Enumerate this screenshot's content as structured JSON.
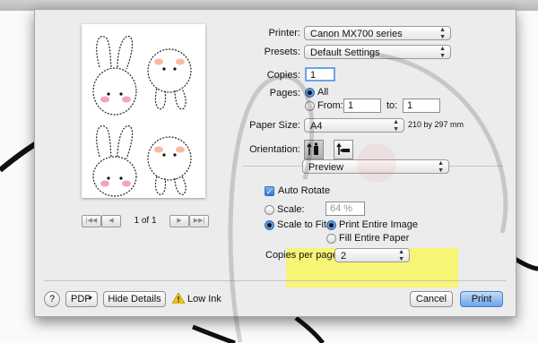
{
  "printer": {
    "label": "Printer:",
    "value": "Canon MX700 series"
  },
  "presets": {
    "label": "Presets:",
    "value": "Default Settings"
  },
  "copies": {
    "label": "Copies:",
    "value": "1"
  },
  "pages": {
    "label": "Pages:",
    "all_label": "All",
    "from_label": "From:",
    "from_value": "1",
    "to_label": "to:",
    "to_value": "1"
  },
  "paper_size": {
    "label": "Paper Size:",
    "value": "A4",
    "dimensions": "210 by 297 mm"
  },
  "orientation": {
    "label": "Orientation:",
    "portrait_icon": "portrait-orientation-icon",
    "landscape_icon": "landscape-orientation-icon"
  },
  "section_popup": {
    "value": "Preview"
  },
  "auto_rotate": {
    "label": "Auto Rotate",
    "checked": true
  },
  "scale": {
    "label": "Scale:",
    "value": "64 %"
  },
  "scale_to_fit": {
    "label": "Scale to Fit:",
    "print_entire": "Print Entire Image",
    "fill_entire": "Fill Entire Paper"
  },
  "copies_per_page": {
    "label": "Copies per page:",
    "value": "2"
  },
  "pager": {
    "count": "1 of 1",
    "first": "|◀◀",
    "prev": "◀",
    "next": "▶",
    "last": "▶▶|"
  },
  "footer": {
    "help": "?",
    "pdf": "PDF",
    "hide_details": "Hide Details",
    "low_ink": "Low Ink",
    "cancel": "Cancel",
    "print": "Print"
  },
  "colors": {
    "highlight": "#f7f56a",
    "accent": "#2f78d6"
  }
}
